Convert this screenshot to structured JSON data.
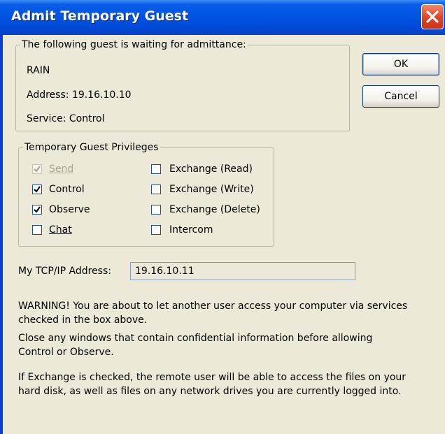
{
  "window": {
    "title": "Admit Temporary Guest",
    "close_icon": "close-icon",
    "accent": "#0054e3",
    "close_color": "#e2462a"
  },
  "guest": {
    "group_label": "The following guest is waiting for admittance:",
    "name": "RAIN",
    "address": "Address: 19.16.10.10",
    "service": "Service: Control"
  },
  "buttons": {
    "ok": "OK",
    "cancel": "Cancel"
  },
  "privileges": {
    "group_label": "Temporary Guest Privileges",
    "items": [
      {
        "label": "Send",
        "checked": true,
        "enabled": false
      },
      {
        "label": "Control",
        "checked": true,
        "enabled": true
      },
      {
        "label": "Observe",
        "checked": true,
        "enabled": true
      },
      {
        "label": "Chat",
        "checked": false,
        "enabled": true
      },
      {
        "label": "Exchange (Read)",
        "checked": false,
        "enabled": true
      },
      {
        "label": "Exchange (Write)",
        "checked": false,
        "enabled": true
      },
      {
        "label": "Exchange (Delete)",
        "checked": false,
        "enabled": true
      },
      {
        "label": "Intercom",
        "checked": false,
        "enabled": true
      }
    ]
  },
  "tcpip": {
    "label": "My TCP/IP Address:",
    "value": "19.16.10.11"
  },
  "warnings": {
    "p1": "WARNING!  You are about to let another user access your computer via services checked in the box above.",
    "p2": "Close any windows that contain confidential information before allowing Control or Observe.",
    "p3": "If Exchange is checked, the remote user will be able to access the files on your hard disk, as well as files on any network drives you are currently logged into."
  }
}
